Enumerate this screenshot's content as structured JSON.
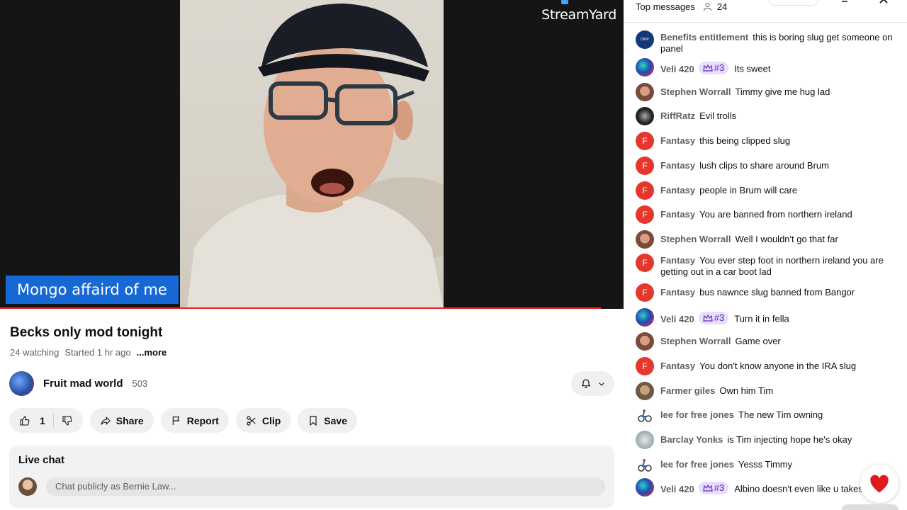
{
  "video": {
    "watermark": "StreamYard",
    "lower_third": "Mongo affaird of me"
  },
  "info": {
    "title": "Becks only mod tonight",
    "watching": "24 watching",
    "started": "Started 1 hr ago",
    "more": "...more",
    "channel_name": "Fruit mad world",
    "subscribers": "503"
  },
  "actions": {
    "like_count": "1",
    "share": "Share",
    "report": "Report",
    "clip": "Clip",
    "save": "Save"
  },
  "live_chat": {
    "title": "Live chat",
    "placeholder": "Chat publicly as Bernie Law..."
  },
  "chat_header": {
    "mode": "Top messages",
    "viewers": "24"
  },
  "messages": [
    {
      "author": "Benefits entitlement",
      "text": "this is boring slug get someone on panel",
      "avatar": "dwp",
      "badge": ""
    },
    {
      "author": "Veli 420",
      "text": "Its sweet",
      "avatar": "veli",
      "badge": "#3"
    },
    {
      "author": "Stephen Worrall",
      "text": "Timmy give me hug lad",
      "avatar": "stephen",
      "badge": ""
    },
    {
      "author": "RiffRatz",
      "text": "Evil trolls",
      "avatar": "riff",
      "badge": ""
    },
    {
      "author": "Fantasy",
      "text": "this being clipped slug",
      "avatar": "F",
      "badge": ""
    },
    {
      "author": "Fantasy",
      "text": "lush clips to share around Brum",
      "avatar": "F",
      "badge": ""
    },
    {
      "author": "Fantasy",
      "text": "people in Brum will care",
      "avatar": "F",
      "badge": ""
    },
    {
      "author": "Fantasy",
      "text": "You are banned from northern ireland",
      "avatar": "F",
      "badge": ""
    },
    {
      "author": "Stephen Worrall",
      "text": "Well I wouldn't go that far",
      "avatar": "stephen",
      "badge": ""
    },
    {
      "author": "Fantasy",
      "text": "You ever step foot in northern ireland you are getting out in a car boot lad",
      "avatar": "F",
      "badge": ""
    },
    {
      "author": "Fantasy",
      "text": "bus nawnce slug banned from Bangor",
      "avatar": "F",
      "badge": ""
    },
    {
      "author": "Veli 420",
      "text": "Turn it in fella",
      "avatar": "veli",
      "badge": "#3"
    },
    {
      "author": "Stephen Worrall",
      "text": "Game over",
      "avatar": "stephen",
      "badge": ""
    },
    {
      "author": "Fantasy",
      "text": "You don't know anyone in the IRA slug",
      "avatar": "F",
      "badge": ""
    },
    {
      "author": "Farmer giles",
      "text": "Own him Tim",
      "avatar": "farmer",
      "badge": ""
    },
    {
      "author": "lee for free jones",
      "text": "The new Tim owning",
      "avatar": "lee",
      "badge": ""
    },
    {
      "author": "Barclay Yonks",
      "text": "is Tim injecting hope he's okay",
      "avatar": "barclay",
      "badge": ""
    },
    {
      "author": "lee for free jones",
      "text": "Yesss Timmy",
      "avatar": "lee",
      "badge": ""
    },
    {
      "author": "Veli 420",
      "text": "Albino doesn't even like u takes the piss",
      "avatar": "veli",
      "badge": "#3"
    }
  ],
  "colors": {
    "fantasy_avatar": "#e5372c",
    "badge_bg": "#e9dcff",
    "lower_third": "#1668d4",
    "progress": "#e22222"
  }
}
